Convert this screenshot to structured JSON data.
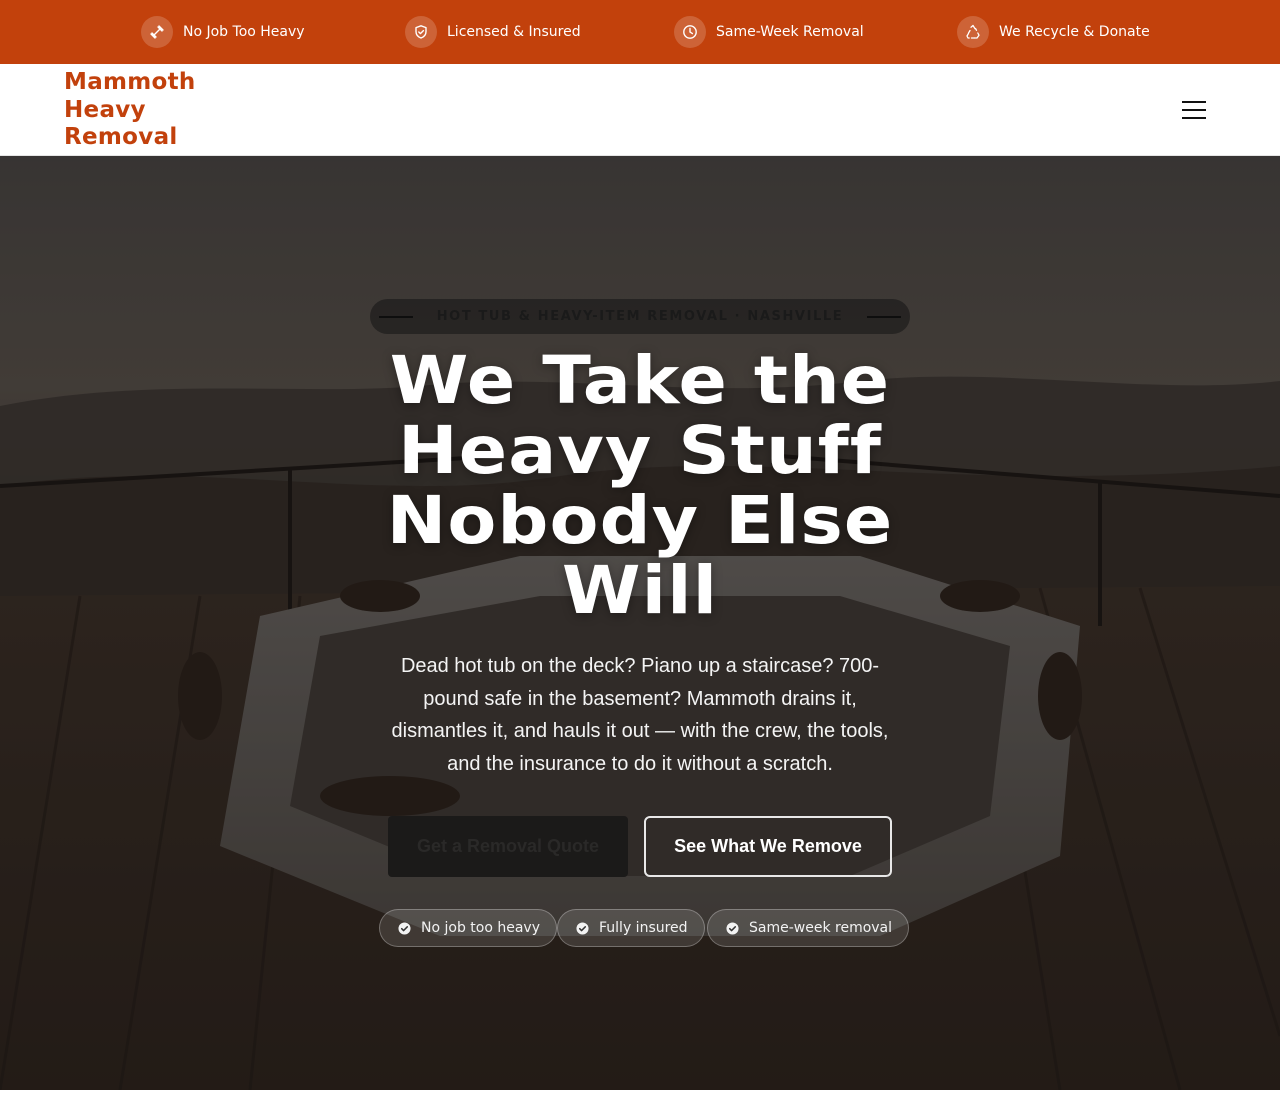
{
  "topbar": {
    "items": [
      {
        "icon": "dumbbell-icon",
        "label": "No Job Too Heavy"
      },
      {
        "icon": "shield-check-icon",
        "label": "Licensed & Insured"
      },
      {
        "icon": "clock-icon",
        "label": "Same-Week Removal"
      },
      {
        "icon": "recycle-icon",
        "label": "We Recycle & Donate"
      }
    ],
    "background": "#c2410c"
  },
  "header": {
    "logo_lines": [
      "Mammoth",
      "Heavy",
      "Removal"
    ],
    "brand_color": "#c2410c",
    "menu_icon": "hamburger-menu-icon"
  },
  "hero": {
    "eyebrow": "Hot Tub & Heavy-Item Removal · Nashville",
    "headline_lines": [
      "We Take the",
      "Heavy Stuff",
      "Nobody Else",
      "Will"
    ],
    "subcopy": "Dead hot tub on the deck? Piano up a staircase? 700-pound safe in the basement? Mammoth drains it, dismantles it, and hauls it out — with the crew, the tools, and the insurance to do it without a scratch.",
    "primary_cta": "Get a Removal Quote",
    "secondary_cta": "See What We Remove",
    "badges": [
      "No job too heavy",
      "Fully insured",
      "Same-week removal"
    ],
    "badge_icon": "check-circle-icon"
  }
}
